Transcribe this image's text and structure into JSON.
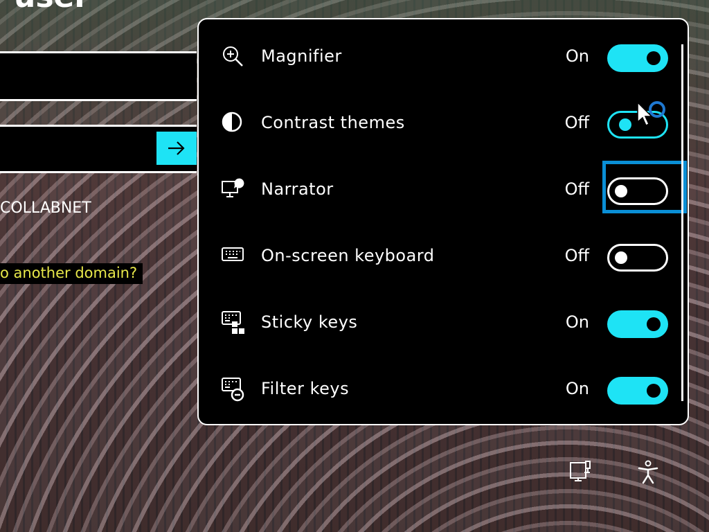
{
  "background": {
    "title_fragment": "user",
    "domain_text": "COLLABNET",
    "other_domain_link": "o another domain?",
    "submit_icon": "arrow-right-icon"
  },
  "quick_settings": {
    "items": [
      {
        "label": "Magnifier",
        "state": "On",
        "icon": "magnifier-icon"
      },
      {
        "label": "Contrast themes",
        "state": "Off",
        "icon": "contrast-icon"
      },
      {
        "label": "Narrator",
        "state": "Off",
        "icon": "narrator-icon"
      },
      {
        "label": "On-screen keyboard",
        "state": "Off",
        "icon": "keyboard-icon"
      },
      {
        "label": "Sticky keys",
        "state": "On",
        "icon": "sticky-keys-icon"
      },
      {
        "label": "Filter keys",
        "state": "On",
        "icon": "filter-keys-icon"
      }
    ]
  },
  "tray": {
    "network_icon": "network-icon",
    "accessibility_icon": "accessibility-icon"
  },
  "colors": {
    "accent": "#1ee3f5",
    "focus": "#0a8fd6",
    "panel_bg": "#000000",
    "link_text": "#e8e84a"
  }
}
